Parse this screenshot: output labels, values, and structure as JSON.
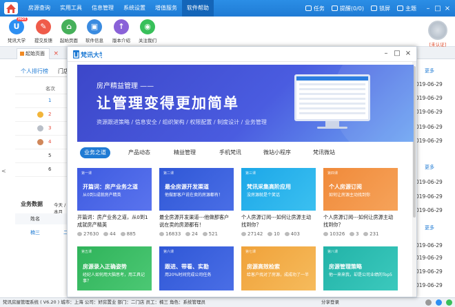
{
  "menu": [
    "房源查询",
    "实用工具",
    "信息管理",
    "系统设置",
    "增值服务",
    "软件帮助"
  ],
  "title_right": {
    "task": "任务",
    "remind": "提醒(0/0)",
    "lock": "锁屏",
    "theme": "主题"
  },
  "toolbar": [
    {
      "label": "梵讯大学",
      "color": "#2d8ff2",
      "hot": "HOT"
    },
    {
      "label": "提交反馈",
      "color": "#ef5b4a"
    },
    {
      "label": "起始页面",
      "color": "#46b05a"
    },
    {
      "label": "软件信息",
      "color": "#3a8be0"
    },
    {
      "label": "版本介绍",
      "color": "#8a62d8"
    },
    {
      "label": "关注我们",
      "color": "#38c05a"
    }
  ],
  "badge_text": "[未认证]",
  "hometab_label": "起始页面",
  "left": {
    "tab1": "个人排行榜",
    "tab2": "门店",
    "col": "名次",
    "ranks": [
      "1",
      "2",
      "3",
      "4",
      "5",
      "6"
    ],
    "biz_title": "业务数据",
    "biz_range": "今天 / 本月",
    "biz_col1": "姓名",
    "biz_col2": "",
    "biz_name": "楠三",
    "biz_val": "二"
  },
  "right": {
    "more": "更多",
    "dates": [
      "019-06-29",
      "019-06-29",
      "019-06-29",
      "019-06-29",
      "019-06-29",
      "019-06-29",
      "019-06-29",
      "019-06-29",
      "019-06-29",
      "019-06-29",
      "019-06-29",
      "019-06-29"
    ]
  },
  "status": {
    "text": "梵讯房屋管理系统 ( V6.20 )   城市：上海   公司：好房置业   部门：二门店   员工：楠三   角色：系统管理员",
    "mid": "分享登录"
  },
  "overlay": {
    "logo": "梵讯大学",
    "banner_sub": "房产精益管理 ——",
    "banner_title": "让管理变得更加简单",
    "banner_tags": "资源跟进策略 / 信息安全 / 组织架构 / 权限配置 / 制度设计 / 业务管理",
    "tabs": [
      "业务之道",
      "产品动态",
      "精益管理",
      "手机梵讯",
      "微站小程序",
      "梵讯微站"
    ],
    "cards": [
      {
        "tag": "第一课",
        "t1": "开篇词：房产业务之道",
        "t2": "从0到1成就房产精英",
        "caption": "开篇词：房产业务之道，从0到1成就房产精英",
        "views": "27630",
        "likes": "44",
        "shares": "885",
        "color": "#3e5be0"
      },
      {
        "tag": "第二课",
        "t1": "最全房源开发渠道",
        "t2": "他做那客户说在卖的房源都有！",
        "caption": "最全房源开发渠道---他做那客户说在卖的房源都有！",
        "views": "16833",
        "likes": "24",
        "shares": "521",
        "color": "#2f57d6"
      },
      {
        "tag": "第三课",
        "t1": "梵讯采集高阶应用",
        "t2": "没房源就是个笑话",
        "caption": "个人房源订阅---如何让房源主动找到你？",
        "views": "27142",
        "likes": "10",
        "shares": "403",
        "color": "#1ca7e8"
      },
      {
        "tag": "第四课",
        "t1": "个人房源订阅",
        "t2": "如何让房源主动找到你",
        "caption": "个人房源订阅---如何让房源主动找到你？",
        "views": "10326",
        "likes": "3",
        "shares": "231",
        "color": "#f08a3a"
      }
    ],
    "cards2": [
      {
        "tag": "第五课",
        "t1": "房源录入正确姿势",
        "t2": "经纪人如何用大脑思考，用工具记事？",
        "color": "#2fb35a"
      },
      {
        "tag": "第六课",
        "t1": "跟进、带看、实勘",
        "t2": "用20%时间完成公司任务",
        "color": "#2f57d6"
      },
      {
        "tag": "第七课",
        "t1": "房源高效检索",
        "t2": "给客户找对了房源，成成功了一半",
        "color": "#f0a23a"
      },
      {
        "tag": "第八课",
        "t1": "房源管理策略",
        "t2": "他一来来我，却是公司业绩的Top5",
        "color": "#22b3a8"
      }
    ]
  }
}
